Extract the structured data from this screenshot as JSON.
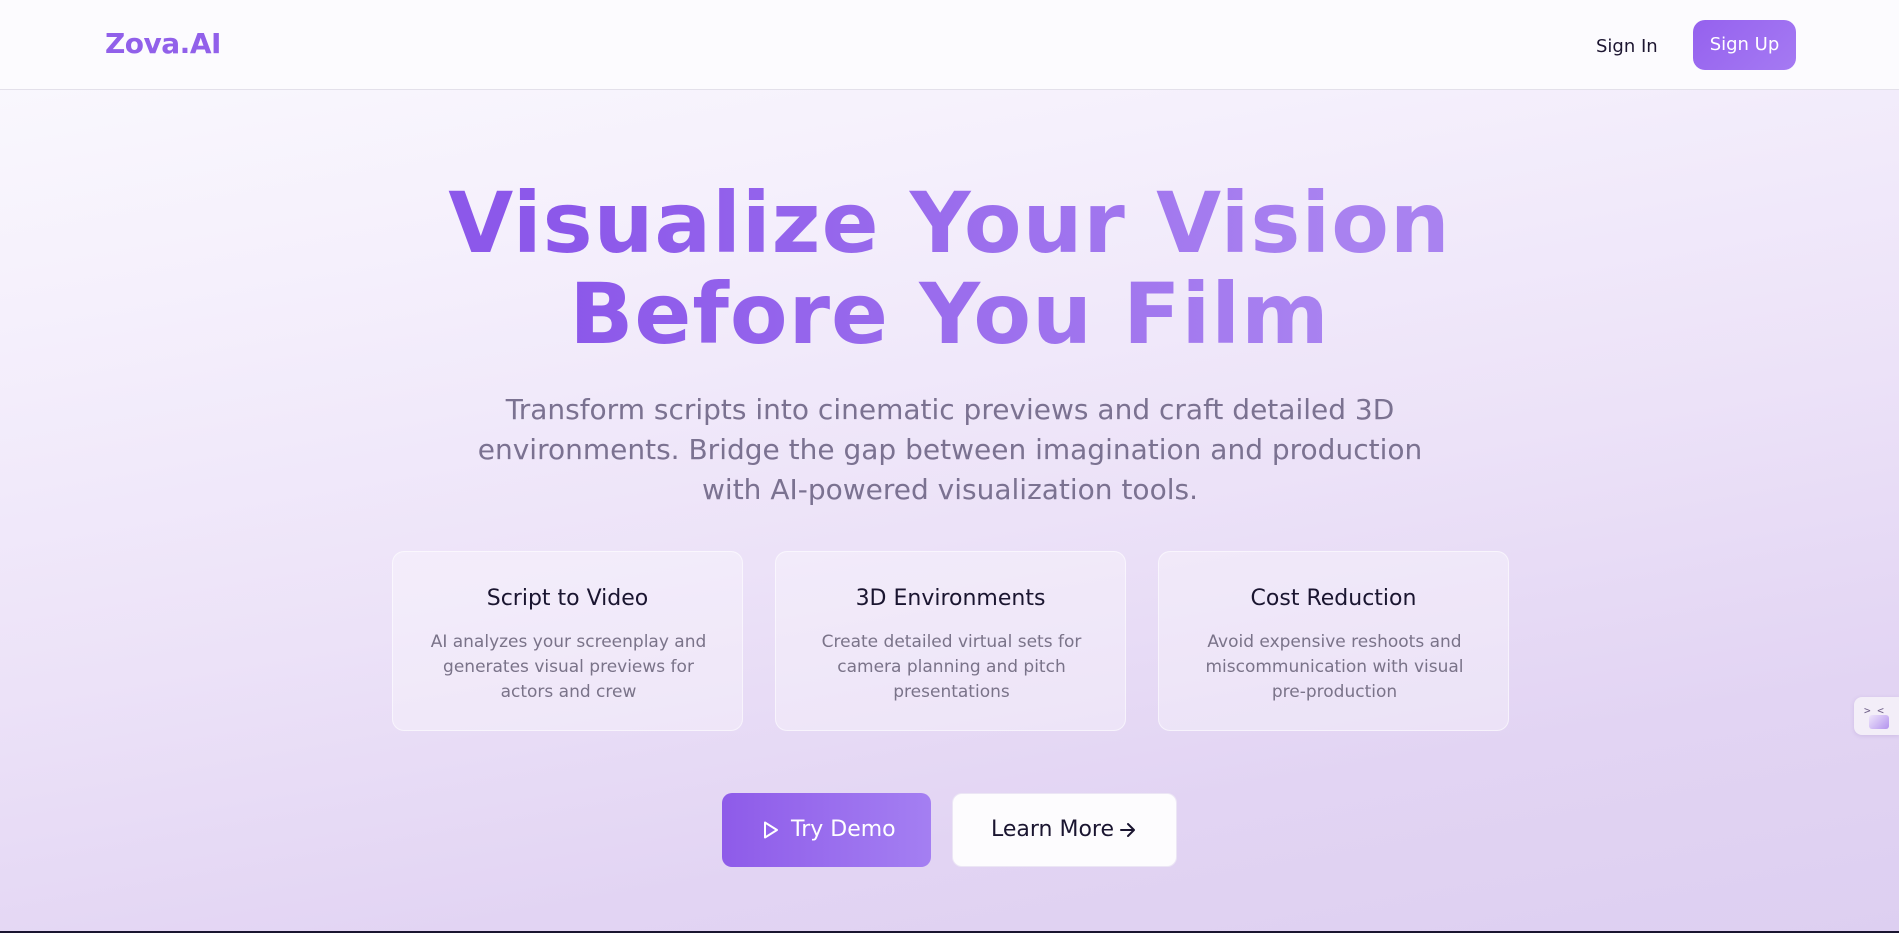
{
  "nav": {
    "logo": "Zova.AI",
    "sign_in": "Sign In",
    "sign_up": "Sign Up"
  },
  "hero": {
    "title_line1": "Visualize Your Vision",
    "title_line2": "Before You Film",
    "subtitle": "Transform scripts into cinematic previews and craft detailed 3D environments. Bridge the gap between imagination and production with AI-powered visualization tools."
  },
  "features": [
    {
      "title": "Script to Video",
      "description": "AI analyzes your screenplay and generates visual previews for actors and crew"
    },
    {
      "title": "3D Environments",
      "description": "Create detailed virtual sets for camera planning and pitch presentations"
    },
    {
      "title": "Cost Reduction",
      "description": "Avoid expensive reshoots and miscommunication with visual pre-production"
    }
  ],
  "cta": {
    "try_demo": "Try Demo",
    "learn_more": "Learn More",
    "try_demo_icon": "play-icon",
    "learn_more_icon": "arrow-right-icon"
  },
  "side_widget": {
    "glyph": ">_<",
    "icon": "widget-icon"
  },
  "colors": {
    "accent": "#9160ea",
    "accent_light": "#a57af3",
    "text_dark": "#1a1530",
    "text_muted": "#7a7389"
  }
}
